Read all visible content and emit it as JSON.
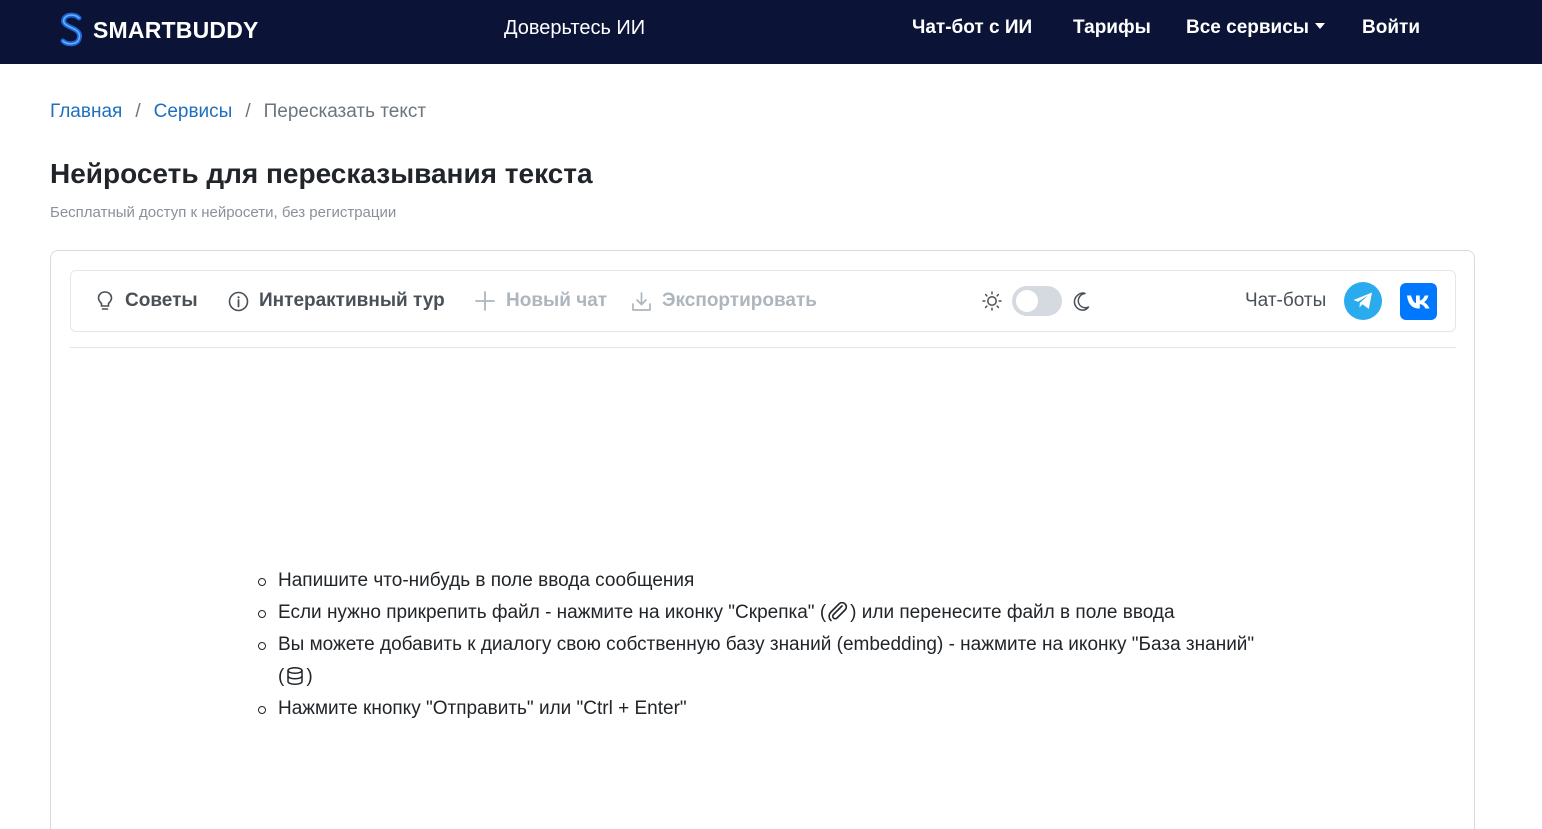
{
  "header": {
    "logo_text": "SMARTBUDDY",
    "tagline": "Доверьтесь ИИ",
    "nav": {
      "chatbot": "Чат-бот с ИИ",
      "pricing": "Тарифы",
      "all_services": "Все сервисы",
      "login": "Войти"
    }
  },
  "breadcrumb": {
    "home": "Главная",
    "sep1": "/",
    "services": "Сервисы",
    "sep2": "/",
    "current": "Пересказать текст"
  },
  "page": {
    "title": "Нейросеть для пересказывания текста",
    "subtitle": "Бесплатный доступ к нейросети, без регистрации"
  },
  "toolbar": {
    "tips": "Советы",
    "tour": "Интерактивный тур",
    "new_chat": "Новый чат",
    "export": "Экспортировать",
    "chatbots_label": "Чат-боты",
    "theme_dark": false
  },
  "hints": {
    "h1": "Напишите что-нибудь в поле ввода сообщения",
    "h2_a": "Если нужно прикрепить файл - нажмите на иконку \"Скрепка\" (",
    "h2_b": ") или перенесите файл в поле ввода",
    "h3_a": "Вы можете добавить к диалогу свою собственную базу знаний (embedding) - нажмите на иконку \"База знаний\" (",
    "h3_b": ")",
    "h4": "Нажмите кнопку \"Отправить\" или \"Ctrl + Enter\""
  },
  "colors": {
    "header_bg": "#0b1437",
    "link": "#1f6fbf",
    "telegram": "#2aabee",
    "vk": "#0077ff"
  },
  "icons": {
    "logo": "smartbuddy-s-logo",
    "tips": "lightbulb-icon",
    "tour": "info-circle-icon",
    "new_chat": "plus-icon",
    "export": "download-icon",
    "light": "sun-icon",
    "dark": "moon-icon",
    "telegram": "telegram-icon",
    "vk": "vk-icon",
    "attach": "paperclip-icon",
    "knowledge": "database-icon"
  }
}
